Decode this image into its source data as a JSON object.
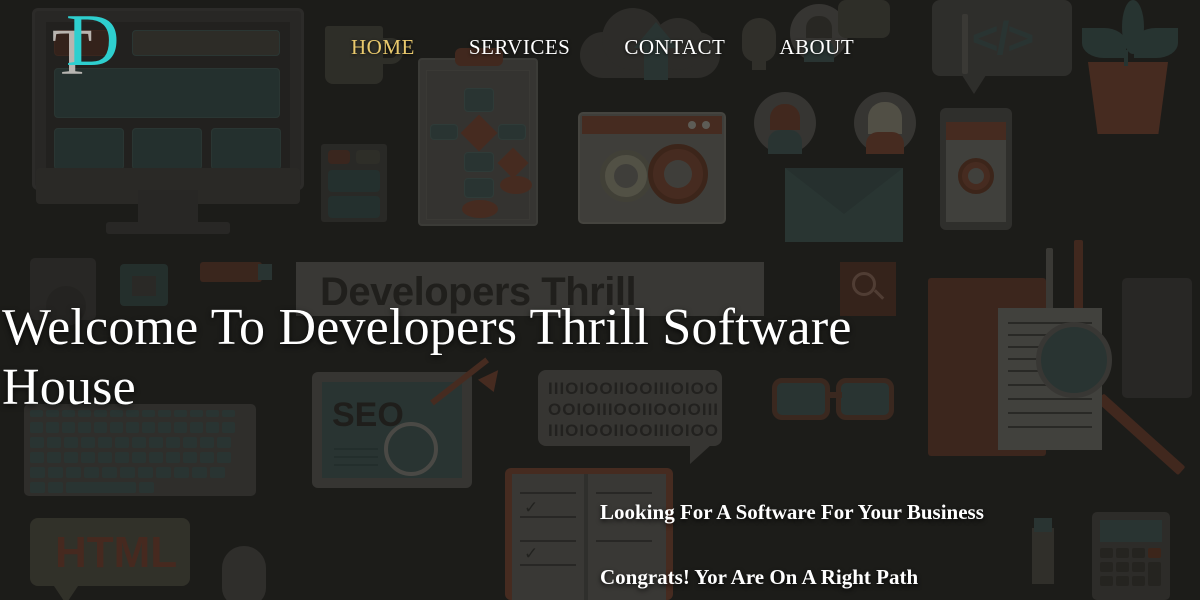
{
  "site": {
    "logo": {
      "primary_letter": "D",
      "secondary_letter": "T",
      "name": "DT"
    }
  },
  "header": {
    "nav": [
      {
        "label": "HOME",
        "active": true
      },
      {
        "label": "SERVICES",
        "active": false
      },
      {
        "label": "CONTACT",
        "active": false
      },
      {
        "label": "ABOUT",
        "active": false
      }
    ]
  },
  "hero": {
    "title": "Welcome To Developers Thrill Software House",
    "tagline_1": "Looking For A Software For Your Business",
    "tagline_2": "Congrats! Yor Are On A Right Path"
  },
  "background_art": {
    "search_widget_text": "Developers Thrill",
    "seo_card_text": "SEO",
    "html_bubble_text": "HTML",
    "binary_bubble_text": "IIIOIOOIIOOIIIOIOO OOIOIIIOOIIOOIOIII IIIOIOOIIOOIIIOIOO",
    "code_bubble_text": "</>"
  },
  "colors": {
    "accent_gold": "#e9c96d",
    "logo_cyan": "#2ecfcf",
    "text_white": "#ffffff",
    "background_dark": "#2b2926",
    "illustration_teal": "#4d6b67",
    "illustration_rust": "#9a5238",
    "illustration_grey": "#7a786f"
  }
}
